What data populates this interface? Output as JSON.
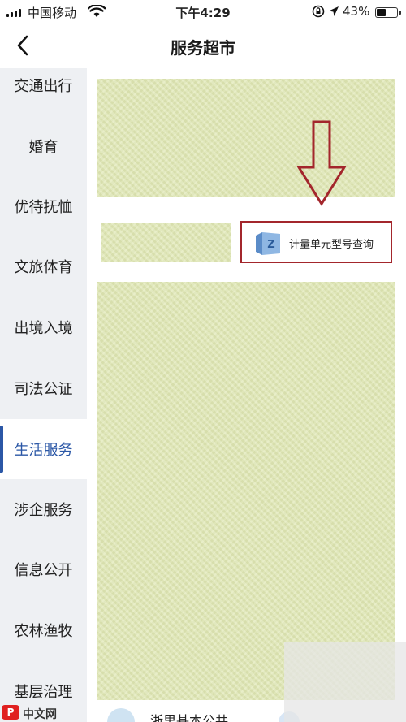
{
  "status_bar": {
    "carrier": "中国移动",
    "time": "下午4:29",
    "battery_percent": "43%",
    "battery_level": 0.43
  },
  "nav": {
    "title": "服务超市",
    "back_icon": "chevron-left-icon"
  },
  "sidebar": {
    "items": [
      {
        "label": "交通出行"
      },
      {
        "label": "婚育"
      },
      {
        "label": "优待抚恤"
      },
      {
        "label": "文旅体育"
      },
      {
        "label": "出境入境"
      },
      {
        "label": "司法公证"
      },
      {
        "label": "生活服务",
        "active": true
      },
      {
        "label": "涉企服务"
      },
      {
        "label": "信息公开"
      },
      {
        "label": "农林渔牧"
      },
      {
        "label": "基层治理"
      }
    ],
    "active_color": "#2b57a6"
  },
  "content": {
    "service_label": "计量单元型号查询",
    "bottom_text": "浙里基本公共",
    "highlight_color": "#a3262c"
  },
  "watermark": {
    "logo": "P",
    "text": "中文网"
  }
}
